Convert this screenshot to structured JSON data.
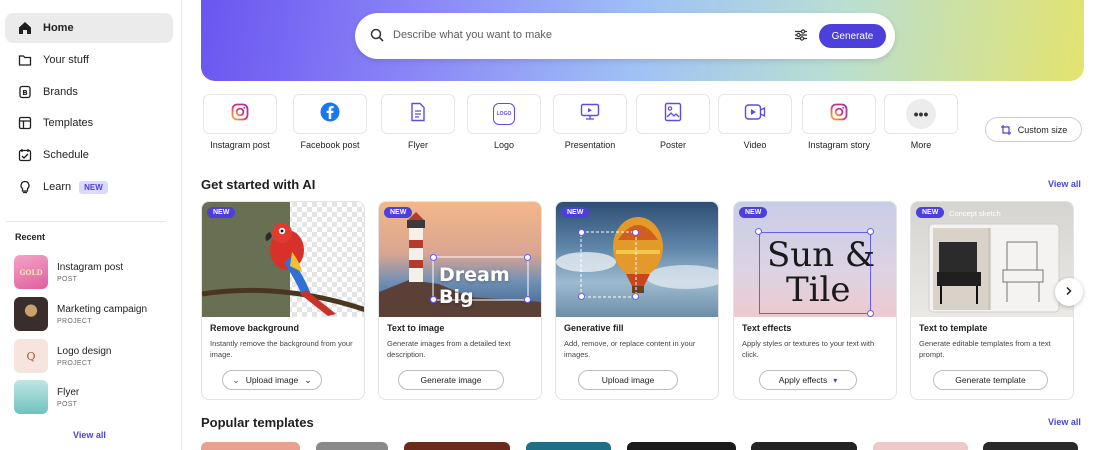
{
  "sidebar": {
    "nav": [
      {
        "label": "Home",
        "icon": "home-icon"
      },
      {
        "label": "Your stuff",
        "icon": "folder-icon"
      },
      {
        "label": "Brands",
        "icon": "brand-icon"
      },
      {
        "label": "Templates",
        "icon": "templates-icon"
      },
      {
        "label": "Schedule",
        "icon": "calendar-icon"
      },
      {
        "label": "Learn",
        "icon": "lightbulb-icon",
        "badge": "NEW"
      }
    ],
    "recent_heading": "Recent",
    "recent": [
      {
        "name": "Instagram post",
        "type": "POST",
        "thumb_text": "GOLD"
      },
      {
        "name": "Marketing campaign",
        "type": "PROJECT"
      },
      {
        "name": "Logo design",
        "type": "PROJECT",
        "thumb_text": "Q"
      },
      {
        "name": "Flyer",
        "type": "POST"
      }
    ],
    "view_all": "View all"
  },
  "search": {
    "placeholder": "Describe what you want to make",
    "generate": "Generate"
  },
  "quick_create": [
    {
      "label": "Instagram post",
      "icon": "instagram-icon"
    },
    {
      "label": "Facebook post",
      "icon": "facebook-icon"
    },
    {
      "label": "Flyer",
      "icon": "flyer-icon"
    },
    {
      "label": "Logo",
      "icon": "logo-icon",
      "icon_text": "LOGO"
    },
    {
      "label": "Presentation",
      "icon": "presentation-icon"
    },
    {
      "label": "Poster",
      "icon": "poster-icon"
    },
    {
      "label": "Video",
      "icon": "video-icon"
    },
    {
      "label": "Instagram story",
      "icon": "instagram-story-icon"
    },
    {
      "label": "More",
      "icon": "more-icon",
      "icon_text": "•••"
    }
  ],
  "custom_size": "Custom size",
  "ai_section": {
    "title": "Get started with AI",
    "view_all": "View all",
    "badge": "NEW",
    "cards": [
      {
        "title": "Remove background",
        "desc": "Instantly remove the background from your image.",
        "button": "Upload image"
      },
      {
        "title": "Text to image",
        "desc": "Generate images from a detailed text description.",
        "button": "Generate image",
        "overlay": "Dream Big"
      },
      {
        "title": "Generative fill",
        "desc": "Add, remove, or replace content in your images.",
        "button": "Upload image"
      },
      {
        "title": "Text effects",
        "desc": "Apply styles or textures to your text with click.",
        "button": "Apply effects",
        "overlay_line1": "Sun &",
        "overlay_line2": "Tile"
      },
      {
        "title": "Text to template",
        "desc": "Generate editable templates from a text prompt.",
        "button": "Generate template",
        "overlay": "Concept sketch"
      }
    ]
  },
  "popular": {
    "title": "Popular templates",
    "view_all": "View all"
  },
  "colors": {
    "accent": "#4d3fd9",
    "link": "#4a45d6"
  }
}
